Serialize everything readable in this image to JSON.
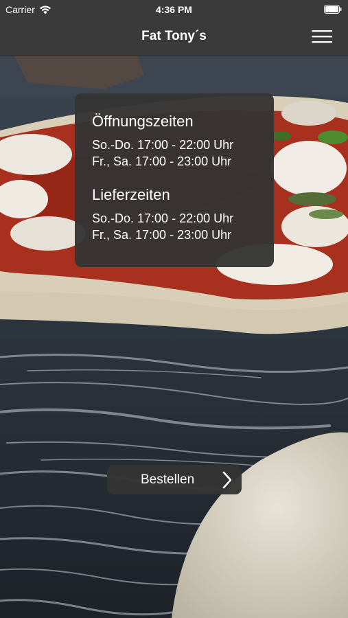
{
  "status_bar": {
    "carrier": "Carrier",
    "time": "4:36 PM",
    "icons": [
      "wifi-icon",
      "battery-icon"
    ]
  },
  "nav_bar": {
    "title": "Fat Tony´s",
    "menu_icon": "hamburger-menu-icon"
  },
  "hours": {
    "opening": {
      "heading": "Öffnungszeiten",
      "lines": [
        "So.-Do. 17:00 - 22:00 Uhr",
        "Fr., Sa. 17:00 - 23:00 Uhr"
      ]
    },
    "delivery": {
      "heading": "Lieferzeiten",
      "lines": [
        "So.-Do. 17:00 - 22:00 Uhr",
        "Fr., Sa. 17:00 - 23:00 Uhr"
      ]
    }
  },
  "order_button": {
    "label": "Bestellen",
    "icon": "chevron-right-icon"
  },
  "background": {
    "subject": "pizza-dough-on-floured-surface"
  }
}
